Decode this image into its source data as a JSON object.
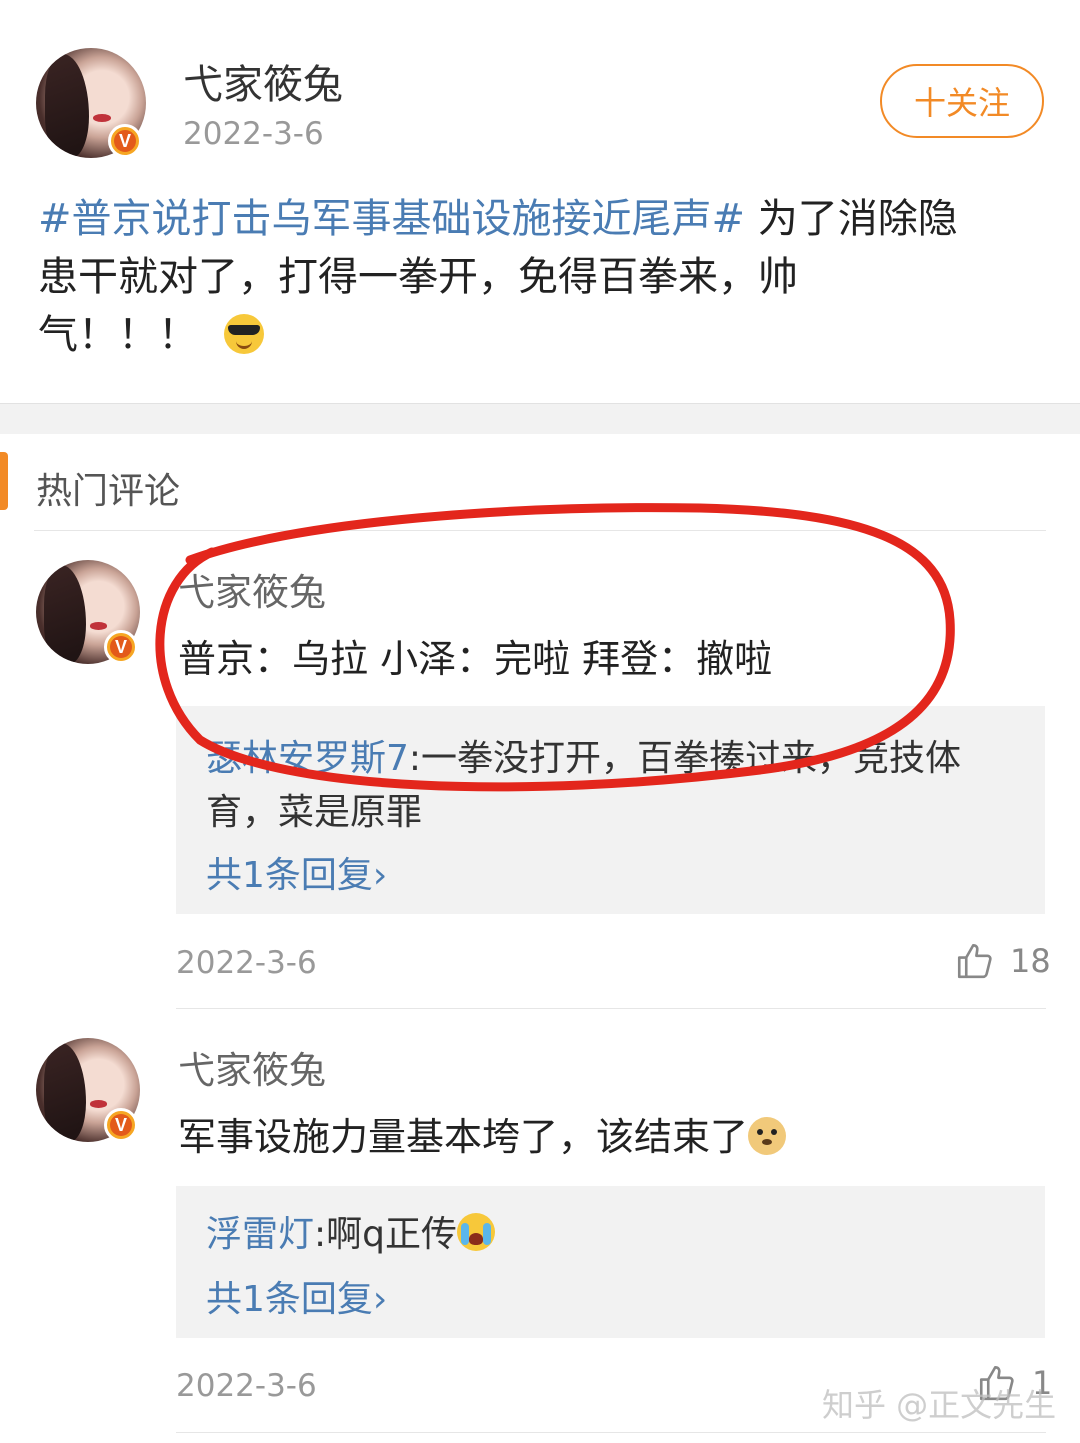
{
  "post": {
    "author": "弋家筱兔",
    "date": "2022-3-6",
    "follow_label": "十关注",
    "topic": "#普京说打击乌军事基础设施接近尾声#",
    "text_line1": " 为了消除隐",
    "text_line2": "患干就对了，打得一拳开，免得百拳来，帅",
    "text_line3": "气！！！"
  },
  "comments_section": {
    "title": "热门评论",
    "comments": [
      {
        "author": "弋家筱兔",
        "text": "普京：乌拉 小泽：完啦 拜登：撤啦",
        "reply_user": "瑟林安罗斯7",
        "reply_text": ":一拳没打开，百拳揍过来，竞技体",
        "reply_text2": "育，菜是原罪",
        "more_replies": "共1条回复›",
        "date": "2022-3-6",
        "likes": "18"
      },
      {
        "author": "弋家筱兔",
        "text": "军事设施力量基本垮了，该结束了",
        "reply_user": "浮雷灯",
        "reply_text": ":啊q正传",
        "more_replies": "共1条回复›",
        "date": "2022-3-6",
        "likes": "1"
      }
    ]
  },
  "watermark": "知乎 @正文先生",
  "colors": {
    "accent": "#f28a26",
    "link": "#4a7cb3",
    "annotation": "#e3261c"
  },
  "icons": [
    "verified-badge-icon",
    "thumbs-up-icon",
    "sunglasses-emoji-icon",
    "doge-emoji-icon",
    "crying-laugh-emoji-icon"
  ]
}
